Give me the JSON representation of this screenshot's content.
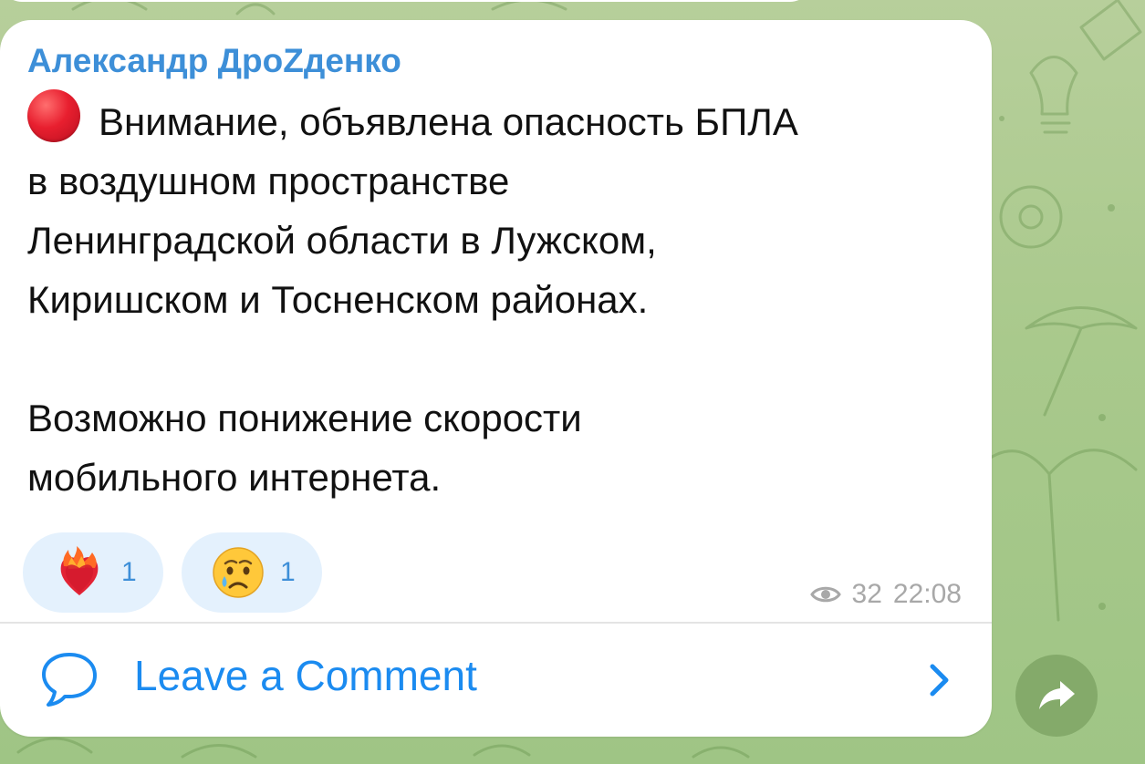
{
  "post": {
    "author": "Александр ДроZденко",
    "message_lines": [
      "Внимание, объявлена опасность БПЛА",
      "в воздушном пространстве",
      "Ленинградской области в Лужском,",
      "Киришском и Тосненском районах.",
      "Возможно понижение скорости",
      "мобильного интернета."
    ],
    "leading_icon": "red-circle-icon",
    "reactions": [
      {
        "icon": "heart-on-fire-icon",
        "count": "1"
      },
      {
        "icon": "crying-face-icon",
        "count": "1"
      }
    ],
    "views": "32",
    "time": "22:08",
    "comment_label": "Leave a Comment"
  },
  "colors": {
    "accent": "#3d8fd8",
    "link": "#1b8bf0",
    "reaction_bg": "#e4f1fd",
    "meta": "#a8a8a8",
    "bubble": "#ffffff",
    "chat_background": "#a9c98c"
  }
}
